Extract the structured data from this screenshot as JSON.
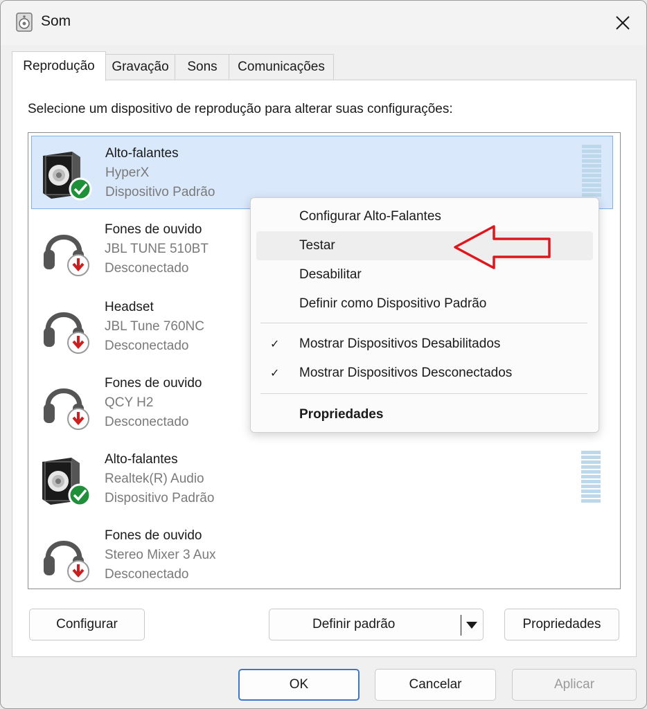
{
  "window": {
    "title": "Som",
    "close_icon": "close-icon"
  },
  "tabs": [
    {
      "label": "Reprodução",
      "active": true
    },
    {
      "label": "Gravação",
      "active": false
    },
    {
      "label": "Sons",
      "active": false
    },
    {
      "label": "Comunicações",
      "active": false
    }
  ],
  "instruction": "Selecione um dispositivo de reprodução para alterar suas configurações:",
  "devices": [
    {
      "name": "Alto-falantes",
      "desc": "HyperX",
      "status": "Dispositivo Padrão",
      "icon": "speaker-default-icon"
    },
    {
      "name": "Fones de ouvido",
      "desc": "JBL TUNE 510BT",
      "status": "Desconectado",
      "icon": "headphones-disconnected-icon"
    },
    {
      "name": "Headset",
      "desc": "JBL Tune 760NC",
      "status": "Desconectado",
      "icon": "headphones-disconnected-icon"
    },
    {
      "name": "Fones de ouvido",
      "desc": "QCY H2",
      "status": "Desconectado",
      "icon": "headphones-disconnected-icon"
    },
    {
      "name": "Alto-falantes",
      "desc": "Realtek(R) Audio",
      "status": "Dispositivo Padrão",
      "icon": "speaker-default-icon"
    },
    {
      "name": "Fones de ouvido",
      "desc": "Stereo Mixer 3 Aux",
      "status": "Desconectado",
      "icon": "headphones-disconnected-icon"
    }
  ],
  "context_menu": {
    "items": [
      {
        "label": "Configurar Alto-Falantes"
      },
      {
        "label": "Testar"
      },
      {
        "label": "Desabilitar"
      },
      {
        "label": "Definir como Dispositivo Padrão"
      },
      {
        "label": "Mostrar Dispositivos Desabilitados",
        "checked": true
      },
      {
        "label": "Mostrar Dispositivos Desconectados",
        "checked": true
      },
      {
        "label": "Propriedades"
      }
    ],
    "check_glyph": "✓"
  },
  "buttons": {
    "configure": "Configurar",
    "set_default": "Definir padrão",
    "properties": "Propriedades",
    "ok": "OK",
    "cancel": "Cancelar",
    "apply": "Aplicar"
  },
  "colors": {
    "selection": "#d9e8fb",
    "accent": "#3a78c9",
    "annotation": "#e0161e",
    "default_check": "#1a8a3a",
    "disconnected_arrow": "#cc1f1f"
  }
}
